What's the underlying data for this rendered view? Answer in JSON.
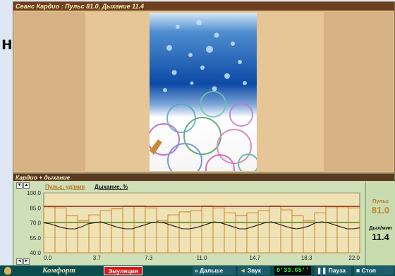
{
  "background_text": "ни",
  "session_window": {
    "title": "Сеанс Кардио : Пульс 81.0, Дыхание 11.4"
  },
  "chart_window": {
    "title": "Кардио + дыхание",
    "legend_pulse": "Пульс, уд/мин",
    "legend_breath": "Дыхание, %",
    "pulse_label": "Пульс",
    "pulse_value": "81.0",
    "breath_label": "Дых/мин",
    "breath_value": "11.4"
  },
  "chart_data": {
    "type": "bar",
    "title": "Кардио + дыхание",
    "x_ticks": [
      "0.0",
      "3.7",
      "7.3",
      "11.0",
      "14.7",
      "18.3",
      "22.0"
    ],
    "y_ticks": [
      "100.0",
      "85.0",
      "70.0",
      "55.0",
      "40.0"
    ],
    "xlim": [
      0,
      22
    ],
    "ylim": [
      40,
      100
    ],
    "bars_pulse": [
      86,
      85,
      77,
      72,
      78,
      82,
      84,
      87,
      87,
      85,
      72,
      78,
      81,
      82,
      87,
      85,
      80,
      77,
      80,
      82,
      87,
      83,
      77,
      72,
      80,
      86,
      86,
      85
    ],
    "pulse_avg": 86.5,
    "pulse_ref": 70.5,
    "breath_line": [
      70,
      69,
      67,
      65,
      64,
      64,
      66,
      69,
      70,
      71,
      69,
      67,
      65,
      64,
      64,
      66,
      68,
      70,
      71,
      70,
      68,
      66,
      64,
      64,
      65,
      67,
      69,
      71,
      70,
      68,
      66,
      64,
      64,
      66,
      68,
      70,
      71,
      69,
      67,
      65,
      64,
      65,
      67,
      70,
      71,
      70,
      68,
      66,
      64,
      64,
      65
    ]
  },
  "colors": {
    "pulse_bar": "#c9812c",
    "pulse_avg_line": "#9b3020",
    "pulse_ref_line": "#6b8a2a",
    "breath_line": "#1a1a1a"
  },
  "taskbar": {
    "logo": "Комфорт",
    "emulation": "Эмуляция",
    "next": "Дальше",
    "sound": "Звук",
    "timer": "0'33.65''",
    "pause": "Пауза",
    "stop": "Стоп"
  }
}
